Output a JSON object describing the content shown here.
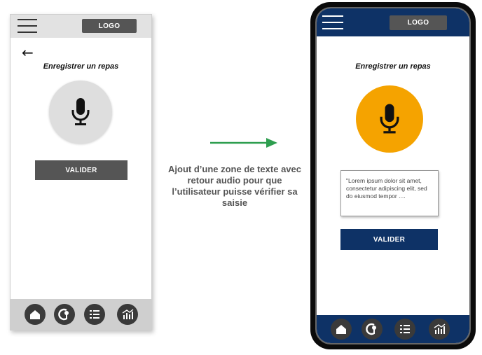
{
  "before": {
    "header": {
      "logo": "LOGO"
    },
    "back_arrow": "←",
    "title": "Enregistrer un repas",
    "mic_icon": "microphone-icon",
    "validate_label": "VALIDER",
    "nav_icons": [
      "home-icon",
      "food-icon",
      "checklist-icon",
      "chart-icon"
    ],
    "colors": {
      "header": "#e2e2e2",
      "mic": "#dedede",
      "button": "#555555",
      "nav": "#cfcfcf"
    }
  },
  "annotation": {
    "text": "Ajout d’une zone de texte avec retour audio pour que l’utilisateur puisse vérifier sa saisie",
    "arrow_color": "#2e9e4f"
  },
  "after": {
    "header": {
      "logo": "LOGO"
    },
    "title": "Enregistrer un repas",
    "mic_icon": "microphone-icon",
    "textbox": "\"Lorem ipsum dolor sit amet, consectetur adipiscing elit, sed do eiusmod tempor ....",
    "validate_label": "VALIDER",
    "nav_icons": [
      "home-icon",
      "food-icon",
      "checklist-icon",
      "chart-icon"
    ],
    "colors": {
      "header": "#0e3266",
      "mic": "#f5a300",
      "button": "#0e3266",
      "nav": "#0e3266"
    }
  }
}
